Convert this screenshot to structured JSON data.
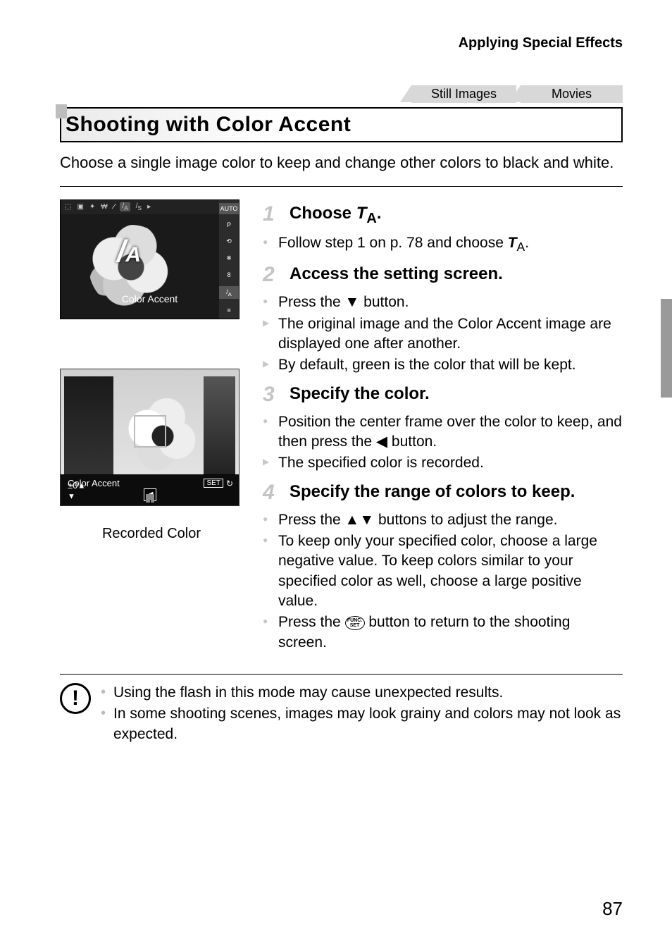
{
  "header": "Applying Special Effects",
  "tabs": {
    "a": "Still Images",
    "b": "Movies"
  },
  "section_title": "Shooting with Color Accent",
  "intro": "Choose a single image color to keep and change other colors to black and white.",
  "screenshot1": {
    "mode_label": "Color Accent",
    "brush_letter": "A",
    "rail": {
      "auto": "AUTO",
      "p": "P"
    }
  },
  "screenshot2": {
    "label": "Color Accent",
    "value": "±0",
    "set": "SET",
    "left_glyph": "◀"
  },
  "recorded_color_caption": "Recorded Color",
  "steps": {
    "s1": {
      "num": "1",
      "title_a": "Choose ",
      "title_icon": "T",
      "title_sub": "A",
      "title_b": ".",
      "b1_a": "Follow step 1 on p. 78 and choose ",
      "b1_b": "."
    },
    "s2": {
      "num": "2",
      "title": "Access the setting screen.",
      "b1_a": "Press the ",
      "b1_glyph": "▼",
      "b1_b": " button.",
      "b2": "The original image and the Color Accent image are displayed one after another.",
      "b3": "By default, green is the color that will be kept."
    },
    "s3": {
      "num": "3",
      "title": "Specify the color.",
      "b1_a": "Position the center frame over the color to keep, and then press the ",
      "b1_glyph": "◀",
      "b1_b": " button.",
      "b2": "The specified color is recorded."
    },
    "s4": {
      "num": "4",
      "title": "Specify the range of colors to keep.",
      "b1_a": "Press the ",
      "b1_glyph": "▲▼",
      "b1_b": " buttons to adjust the range.",
      "b2": "To keep only your specified color, choose a large negative value. To keep colors similar to your specified color as well, choose a large positive value.",
      "b3_a": "Press the ",
      "b3_func_top": "FUNC.",
      "b3_func_bot": "SET",
      "b3_b": " button to return to the shooting screen."
    }
  },
  "callout": {
    "c1": "Using the flash in this mode may cause unexpected results.",
    "c2": "In some shooting scenes, images may look grainy and colors may not look as expected."
  },
  "page_number": "87"
}
